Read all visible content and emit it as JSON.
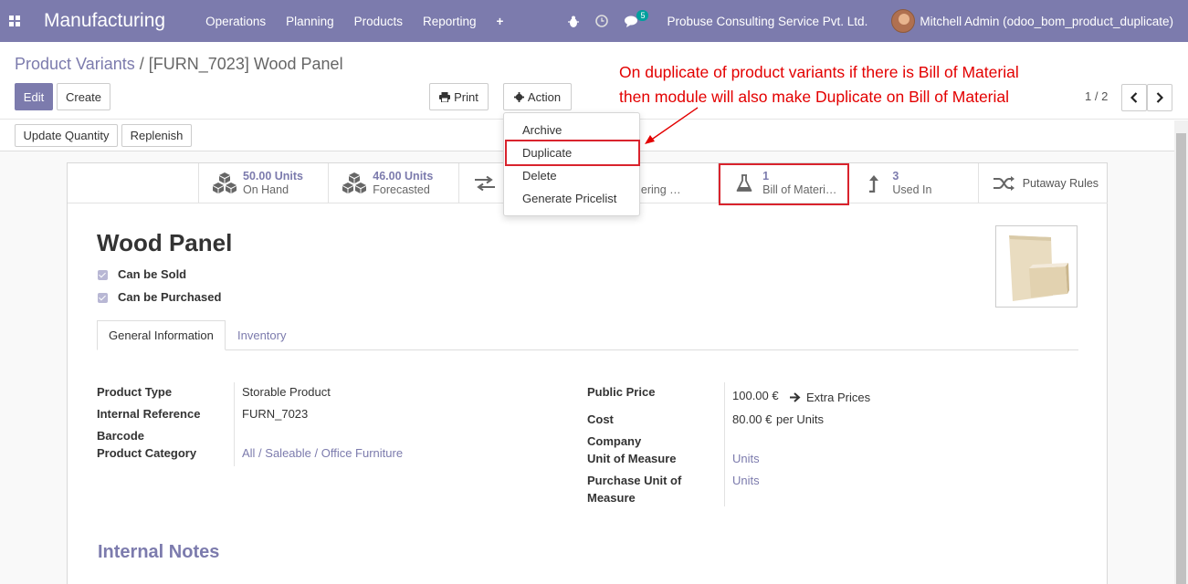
{
  "navbar": {
    "app_name": "Manufacturing",
    "menu": [
      "Operations",
      "Planning",
      "Products",
      "Reporting"
    ],
    "plus": "+",
    "messages_count": "5",
    "company": "Probuse Consulting Service Pvt. Ltd.",
    "user": "Mitchell Admin (odoo_bom_product_duplicate)",
    "icons": [
      "apps-grid-icon",
      "bug-icon",
      "clock-icon",
      "chat-icon"
    ],
    "color": "#7c7bad"
  },
  "breadcrumb": {
    "parent": "Product Variants",
    "separator": "/",
    "current": "[FURN_7023] Wood Panel"
  },
  "toolbar": {
    "edit": "Edit",
    "create": "Create",
    "print": "Print",
    "action": "Action",
    "update_quantity": "Update Quantity",
    "replenish": "Replenish",
    "pager": "1 / 2"
  },
  "action_menu": {
    "items": [
      "Archive",
      "Duplicate",
      "Delete",
      "Generate Pricelist"
    ],
    "highlighted": "Duplicate"
  },
  "annotation": {
    "line1": "On duplicate of product variants if there is Bill of Material",
    "line2": "then module will also make Duplicate on Bill of Material",
    "color": "#e30000"
  },
  "smart_buttons": [
    {
      "value": "50.00 Units",
      "label": "On Hand",
      "icon": "cubes-icon"
    },
    {
      "value": "46.00 Units",
      "label": "Forecasted",
      "icon": "cubes-icon"
    },
    {
      "value": "",
      "label": "R",
      "icon": "exchange-icon"
    },
    {
      "value": "",
      "label": "eordering …",
      "icon": "refresh-icon"
    },
    {
      "value": "1",
      "label": "Bill of Materi…",
      "icon": "flask-icon"
    },
    {
      "value": "3",
      "label": "Used In",
      "icon": "level-up-icon"
    },
    {
      "value": "",
      "label": "Putaway Rules",
      "icon": "random-icon"
    }
  ],
  "product": {
    "name": "Wood Panel",
    "can_be_sold": "Can be Sold",
    "can_be_purchased": "Can be Purchased"
  },
  "tabs": [
    "General Information",
    "Inventory"
  ],
  "fields_left": [
    {
      "label": "Product Type",
      "value": "Storable Product"
    },
    {
      "label": "Internal Reference",
      "value": "FURN_7023"
    },
    {
      "label": "Barcode",
      "value": ""
    },
    {
      "label": "Product Category",
      "value": "All / Saleable / Office Furniture"
    }
  ],
  "fields_right": {
    "public_price_label": "Public Price",
    "public_price_value": "100.00 €",
    "extra_prices": "Extra Prices",
    "cost_label": "Cost",
    "cost_value": "80.00 €",
    "cost_unit": "per Units",
    "company_label": "Company",
    "uom_label": "Unit of Measure",
    "uom_value": "Units",
    "purchase_uom_label_1": "Purchase Unit of",
    "purchase_uom_label_2": "Measure",
    "purchase_uom_value": "Units"
  },
  "internal_notes": "Internal Notes"
}
